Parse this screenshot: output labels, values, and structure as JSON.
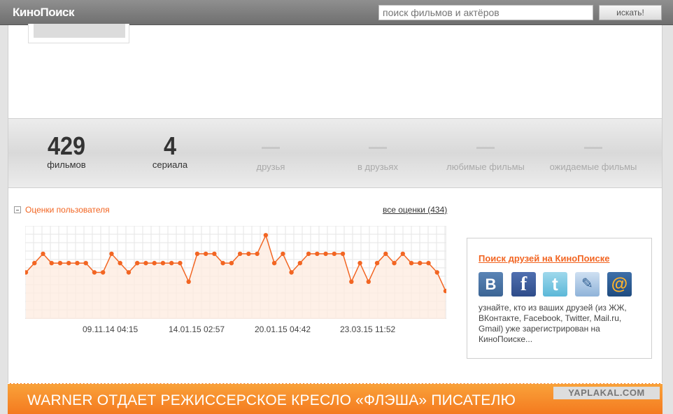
{
  "header": {
    "logo": "КиноПоиск",
    "search_placeholder": "поиск фильмов и актёров",
    "search_button": "искать!"
  },
  "stats": [
    {
      "value": "429",
      "label": "фильмов"
    },
    {
      "value": "4",
      "label": "сериала"
    },
    {
      "value": "",
      "label": "друзья"
    },
    {
      "value": "",
      "label": "в друзьях"
    },
    {
      "value": "",
      "label": "любимые фильмы"
    },
    {
      "value": "",
      "label": "ожидаемые фильмы"
    }
  ],
  "ratings": {
    "title": "Оценки пользователя",
    "all_link": "все оценки (434)"
  },
  "chart_data": {
    "type": "line",
    "x_labels": [
      "09.11.14 04:15",
      "14.01.15 02:57",
      "20.01.15 04:42",
      "23.03.15 11:52"
    ],
    "values": [
      5,
      6,
      7,
      6,
      6,
      6,
      6,
      6,
      5,
      5,
      7,
      6,
      5,
      6,
      6,
      6,
      6,
      6,
      6,
      4,
      7,
      7,
      7,
      6,
      6,
      7,
      7,
      7,
      9,
      6,
      7,
      5,
      6,
      7,
      7,
      7,
      7,
      7,
      4,
      6,
      4,
      6,
      7,
      6,
      7,
      6,
      6,
      6,
      5,
      3
    ],
    "ylim": [
      0,
      10
    ],
    "line_color": "#f26522",
    "fill_color": "#fdebdf",
    "grid": true
  },
  "friends": {
    "title": "Поиск друзей на КиноПоиске",
    "icons": [
      "vk-icon",
      "facebook-icon",
      "twitter-icon",
      "livejournal-icon",
      "mailru-icon"
    ],
    "icon_glyphs": [
      "В",
      "f",
      "t",
      "✎",
      "@"
    ],
    "text": "узнайте, кто из ваших друзей (из ЖЖ, ВКонтакте, Facebook, Twitter, Mail.ru, Gmail) уже зарегистрирован на КиноПоиске..."
  },
  "banner": {
    "text": "WARNER ОТДАЕТ РЕЖИССЕРСКОЕ КРЕСЛО «ФЛЭША» ПИСАТЕЛЮ",
    "watermark": "YAPLAKAL.COM"
  }
}
